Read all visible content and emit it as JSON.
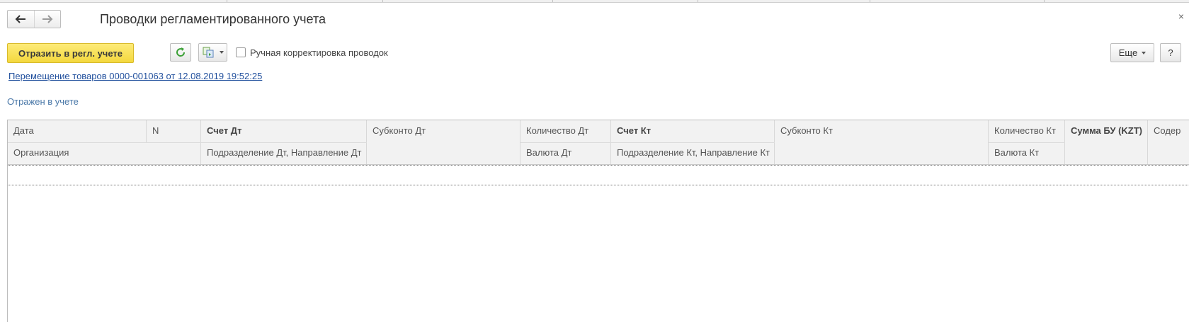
{
  "window": {
    "title": "Проводки регламентированного учета",
    "close_glyph": "×"
  },
  "nav": {
    "back_icon": "arrow-left-icon",
    "forward_icon": "arrow-right-icon"
  },
  "toolbar": {
    "post_button_label": "Отразить в регл. учете",
    "refresh_icon": "refresh-icon",
    "copy_icon": "copy-documents-icon",
    "manual_correction_label": "Ручная корректировка проводок",
    "manual_correction_checked": false,
    "more_button_label": "Еще",
    "help_button_label": "?"
  },
  "document_link": "Перемещение товаров 0000-001063 от 12.08.2019 19:52:25",
  "status_text": "Отражен в учете",
  "table": {
    "columns_row1": {
      "date": "Дата",
      "n": "N",
      "account_dt": "Счет Дт",
      "subconto_dt": "Субконто Дт",
      "qty_dt": "Количество Дт",
      "account_kt": "Счет Кт",
      "subconto_kt": "Субконто Кт",
      "qty_kt": "Количество Кт",
      "sum_bu": "Сумма БУ (KZT)",
      "content": "Содер"
    },
    "columns_row2": {
      "organization": "Организация",
      "division_dt": "Подразделение Дт, Направление Дт",
      "currency_dt": "Валюта Дт",
      "division_kt": "Подразделение Кт, Направление Кт",
      "currency_kt": "Валюта Кт"
    },
    "rows": []
  },
  "colors": {
    "primary_button": "#f4d83e",
    "link": "#1f4e9c",
    "status": "#4a78a8",
    "refresh_icon": "#3aa035"
  }
}
